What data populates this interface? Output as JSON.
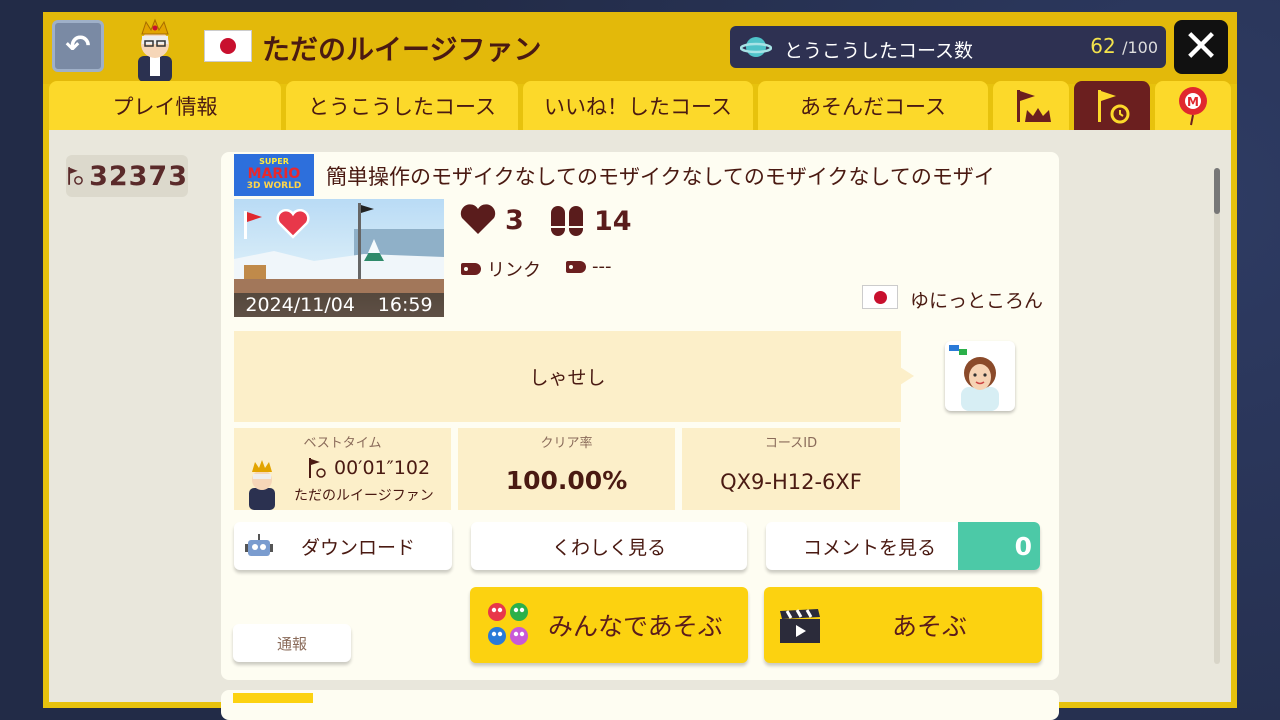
{
  "header": {
    "user_name": "ただのルイージファン",
    "course_count_label": "とうこうしたコース数",
    "course_count": "62",
    "course_count_max": "/100"
  },
  "tabs": [
    {
      "label": "プレイ情報"
    },
    {
      "label": "とうこうしたコース"
    },
    {
      "label": "いいね！したコース"
    },
    {
      "label": "あそんだコース"
    },
    {
      "icon": "flag-crown-icon"
    },
    {
      "icon": "flag-timer-icon",
      "active": true
    },
    {
      "icon": "balloon-m-icon"
    }
  ],
  "sidebar": {
    "first_clear_count": "32373"
  },
  "course": {
    "game_logo_line1": "SUPER",
    "game_logo_line2": "MARIO",
    "game_logo_line3": "3D WORLD",
    "title": "簡単操作のモザイクなしてのモザイクなしてのモザイクなしてのモザイ",
    "upload_datetime_date": "2024/11/04",
    "upload_datetime_time": "16:59",
    "likes": "3",
    "plays": "14",
    "tag1": "リンク",
    "tag2": "---",
    "maker_name": "ゆにっところん",
    "description": "しゃせし",
    "best_time_caption": "ベストタイム",
    "best_time": "00′01″102",
    "best_time_holder": "ただのルイージファン",
    "clear_rate_caption": "クリア率",
    "clear_rate": "100.00%",
    "course_id_caption": "コースID",
    "course_id": "QX9-H12-6XF"
  },
  "buttons": {
    "download": "ダウンロード",
    "details": "くわしく見る",
    "comments": "コメントを見る",
    "comment_count": "0",
    "report": "通報",
    "multiplayer": "みんなであそぶ",
    "play": "あそぶ"
  },
  "colors": {
    "frame_yellow": "#e7c20d",
    "tab_yellow": "#fcd92a",
    "tab_active": "#6b1f1f",
    "comment_teal": "#4cc9a7",
    "text_brown": "#4a1a12"
  }
}
